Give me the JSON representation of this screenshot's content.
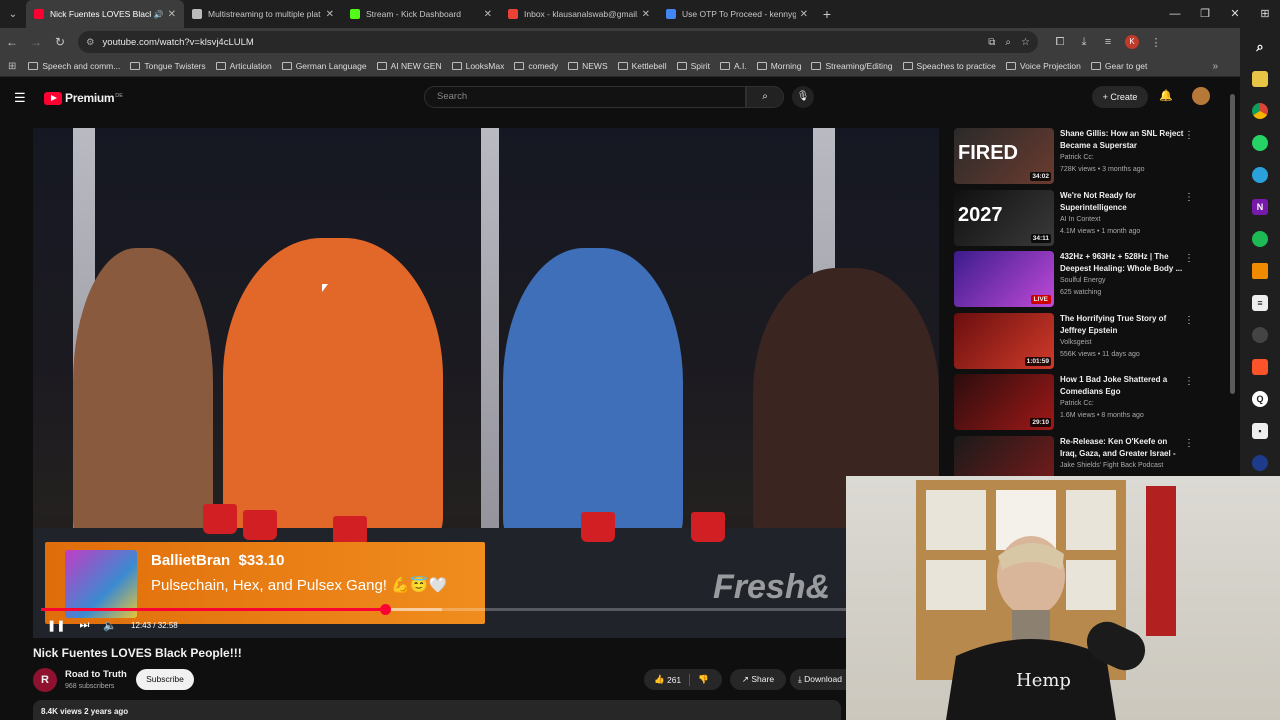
{
  "browser": {
    "tabs": [
      {
        "title": "Nick Fuentes LOVES Black P",
        "active": true,
        "color": "#ff0033"
      },
      {
        "title": "Multistreaming to multiple plat",
        "active": false,
        "color": "#bbbbbb"
      },
      {
        "title": "Stream - Kick Dashboard",
        "active": false,
        "color": "#53fc18"
      },
      {
        "title": "Inbox - klausanalswab@gmail.c",
        "active": false,
        "color": "#ea4335"
      },
      {
        "title": "Use OTP To Proceed - kennygre",
        "active": false,
        "color": "#4285f4"
      }
    ],
    "url": "youtube.com/watch?v=klsvj4cLULM",
    "profile_initial": "K",
    "bookmarks": [
      "Speech and comm...",
      "Tongue Twisters",
      "Articulation",
      "German Language",
      "AI NEW GEN",
      "LooksMax",
      "comedy",
      "NEWS",
      "Kettlebell",
      "Spirit",
      "A.I.",
      "Morning",
      "Streaming/Editing",
      "Speaches to practice",
      "Voice Projection",
      "Gear to get"
    ]
  },
  "youtube": {
    "logo_text": "Premium",
    "logo_region": "DE",
    "search_placeholder": "Search",
    "create_label": "Create"
  },
  "player": {
    "superchat_name": "BallietBran",
    "superchat_amount": "$33.10",
    "superchat_message": "Pulsechain, Hex, and Pulsex Gang! 💪😇🤍",
    "watermark": "Fresh&",
    "time_display": "12:43 / 32:58",
    "progress_fraction": 0.386,
    "buffered_fraction": 0.45
  },
  "video": {
    "title": "Nick Fuentes LOVES Black People!!!",
    "channel": "Road to Truth",
    "channel_initial": "R",
    "subscribers": "968 subscribers",
    "subscribe_label": "Subscribe",
    "likes": "261",
    "share_label": "Share",
    "download_label": "Download",
    "views_meta": "8.4K views  2 years ago"
  },
  "recommendations": [
    {
      "title": "Shane Gillis: How an SNL Reject Became a Superstar",
      "channel": "Patrick Cc:",
      "meta": "728K views • 3 months ago",
      "duration": "34:02",
      "thumb_text": "FIRED",
      "colors": [
        "#2a2a2a",
        "#6b3b2f"
      ]
    },
    {
      "title": "We're Not Ready for Superintelligence",
      "channel": "AI In Context",
      "meta": "4.1M views • 1 month ago",
      "duration": "34:11",
      "thumb_text": "2027",
      "colors": [
        "#101010",
        "#3a3a3a"
      ]
    },
    {
      "title": "432Hz + 963Hz + 528Hz | The Deepest Healing: Whole Body ...",
      "channel": "Soulful Energy",
      "meta": "625 watching",
      "duration": "LIVE",
      "thumb_text": "",
      "colors": [
        "#3b1c8c",
        "#c04ad8"
      ]
    },
    {
      "title": "The Horrifying True Story of Jeffrey Epstein",
      "channel": "Volksgeist",
      "meta": "556K views • 11 days ago",
      "duration": "1:01:59",
      "thumb_text": "",
      "colors": [
        "#6a0f0f",
        "#d13a2a"
      ]
    },
    {
      "title": "How 1 Bad Joke Shattered a Comedians Ego",
      "channel": "Patrick Cc:",
      "meta": "1.6M views • 8 months ago",
      "duration": "29:10",
      "thumb_text": "",
      "colors": [
        "#2b0d0d",
        "#a01818"
      ]
    },
    {
      "title": "Re-Release: Ken O'Keefe on Iraq, Gaza, and Greater Israel - ...",
      "channel": "Jake Shields' Fight Back Podcast",
      "meta": "",
      "duration": "",
      "thumb_text": "",
      "colors": [
        "#1a1a1a",
        "#7a1a1a"
      ]
    }
  ],
  "webcam": {
    "shirt_text": "Hemp"
  }
}
